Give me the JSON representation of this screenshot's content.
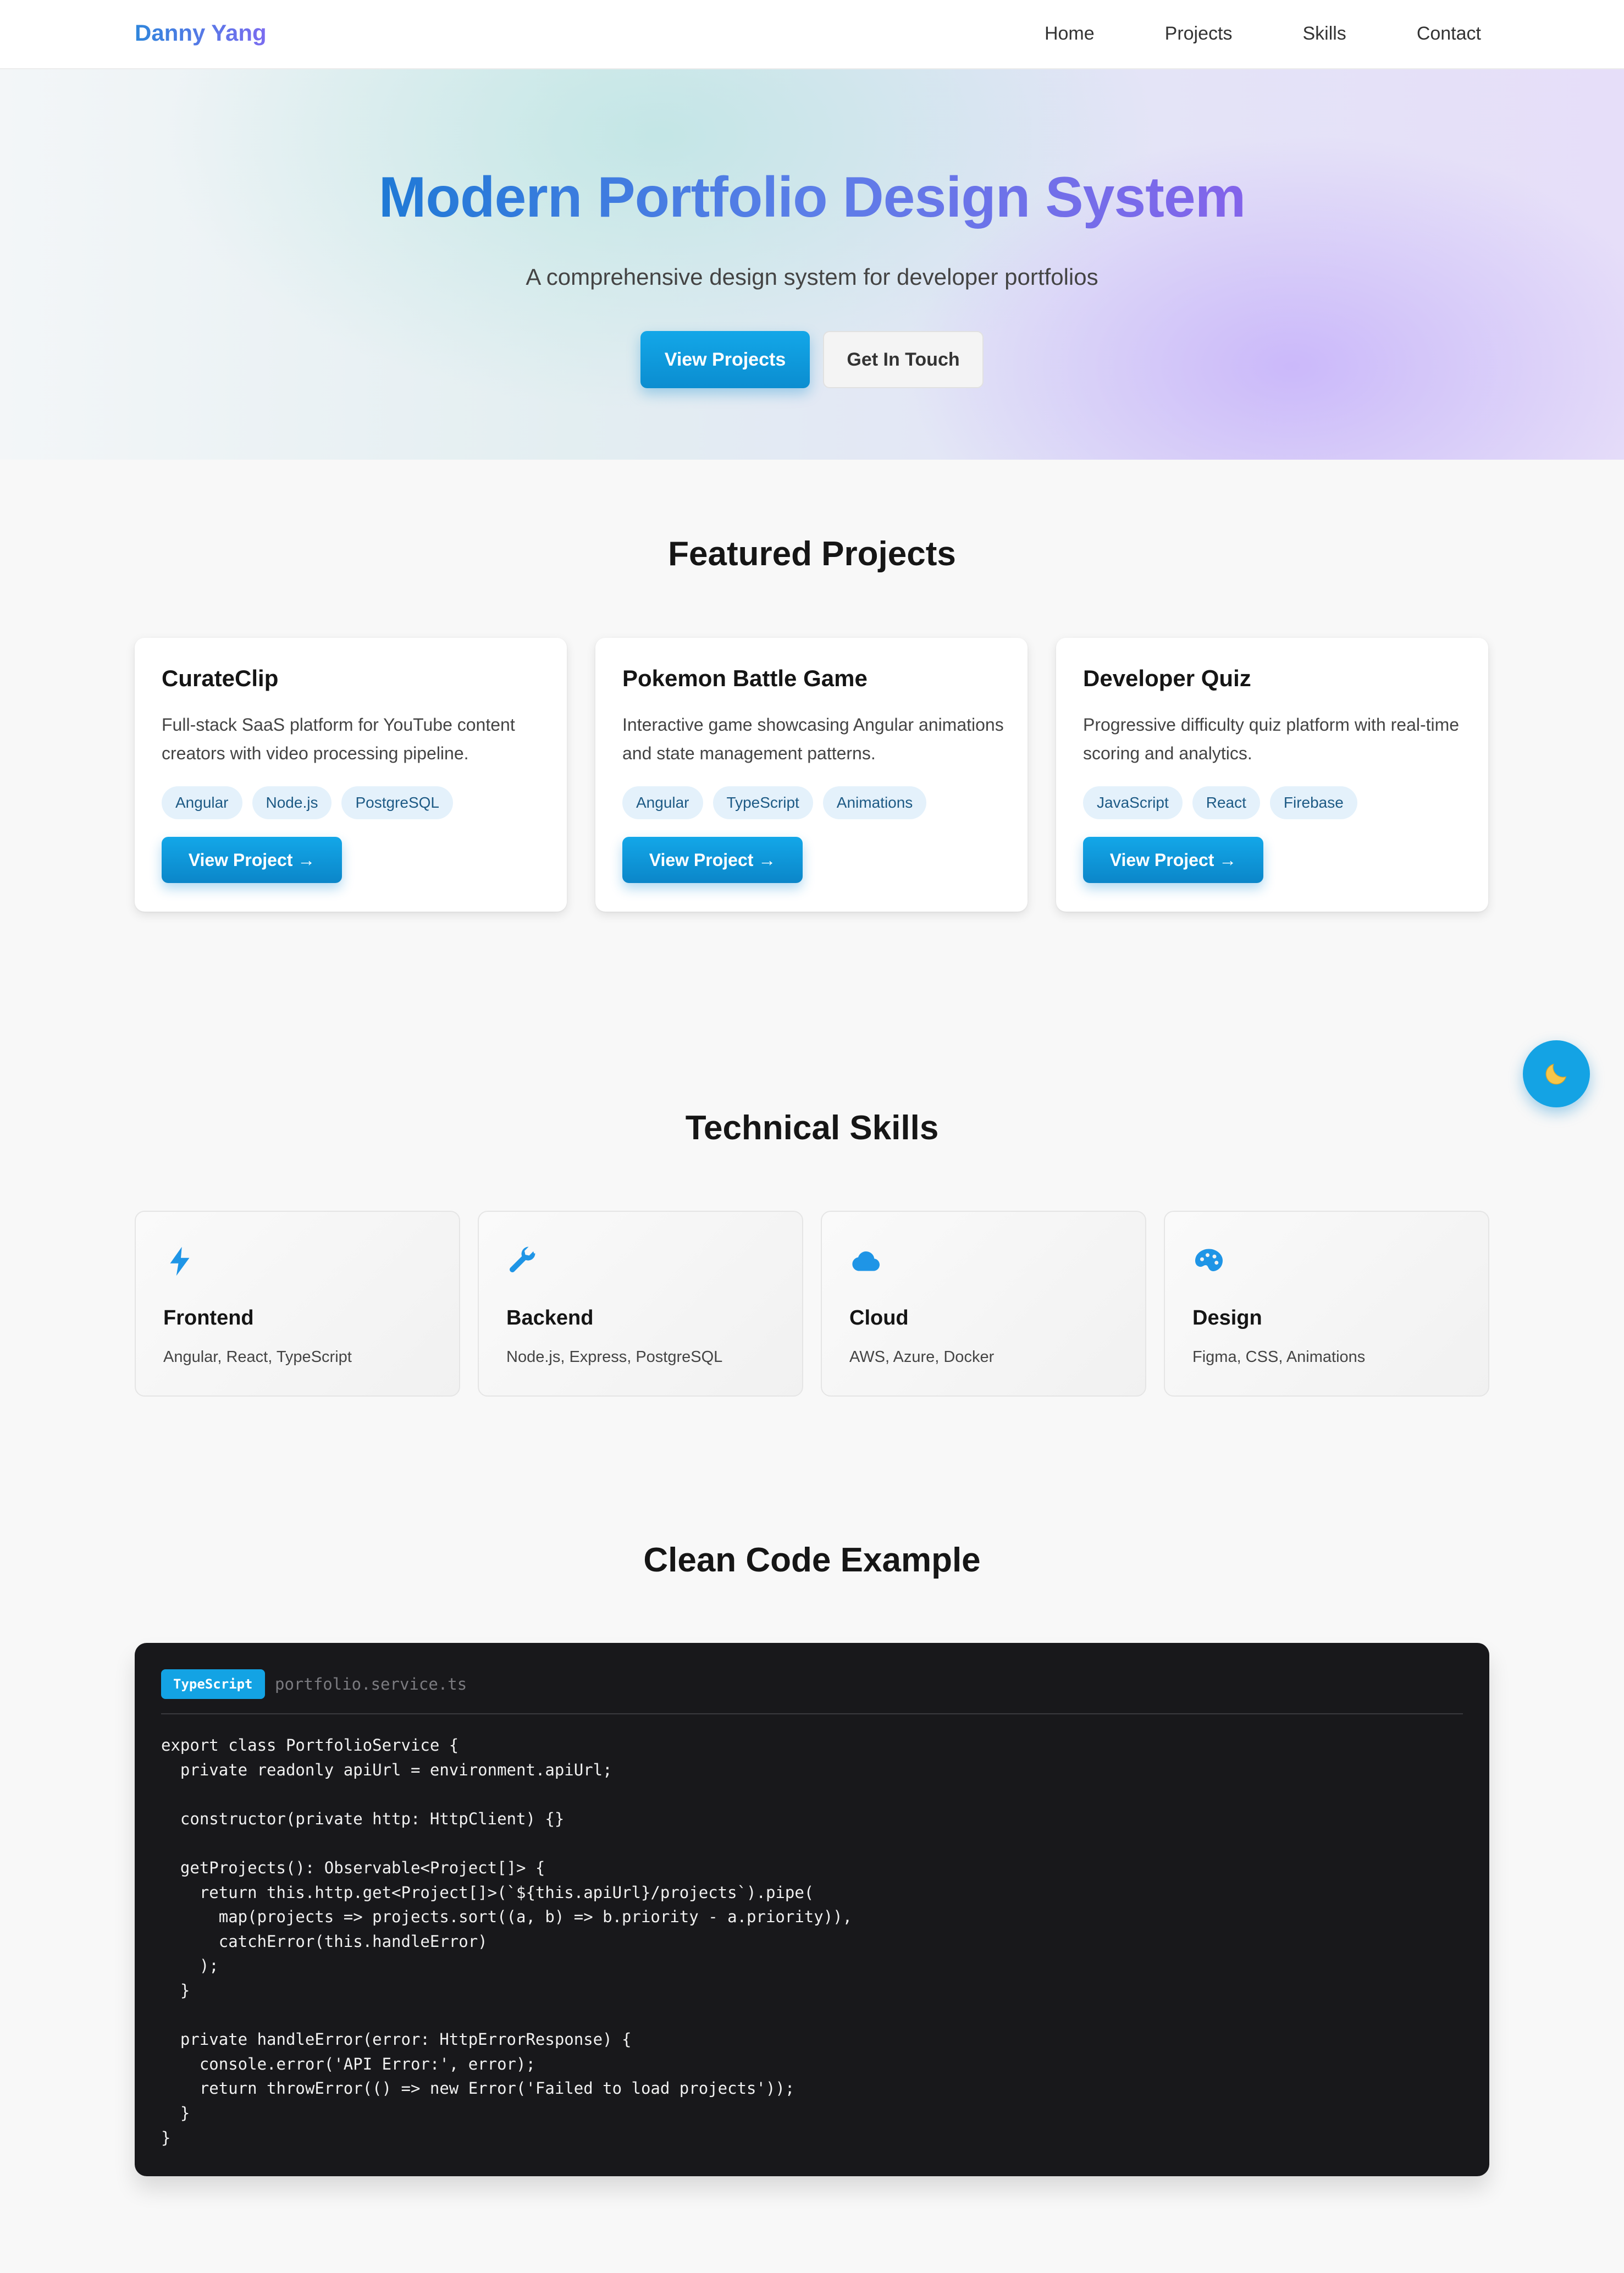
{
  "nav": {
    "brand": "Danny Yang",
    "links": [
      "Home",
      "Projects",
      "Skills",
      "Contact"
    ]
  },
  "hero": {
    "title": "Modern Portfolio Design System",
    "subtitle": "A comprehensive design system for developer portfolios",
    "primary_button": "View Projects",
    "secondary_button": "Get In Touch"
  },
  "projects": {
    "title": "Featured Projects",
    "cards": [
      {
        "title": "CurateClip",
        "description": "Full-stack SaaS platform for YouTube content creators with video processing pipeline.",
        "tags": [
          "Angular",
          "Node.js",
          "PostgreSQL"
        ],
        "button": "View Project →"
      },
      {
        "title": "Pokemon Battle Game",
        "description": "Interactive game showcasing Angular animations and state management patterns.",
        "tags": [
          "Angular",
          "TypeScript",
          "Animations"
        ],
        "button": "View Project →"
      },
      {
        "title": "Developer Quiz",
        "description": "Progressive difficulty quiz platform with real-time scoring and analytics.",
        "tags": [
          "JavaScript",
          "React",
          "Firebase"
        ],
        "button": "View Project →"
      }
    ]
  },
  "theme_toggle": {
    "icon": "moon-icon",
    "glyph": "🌙"
  },
  "skills": {
    "title": "Technical Skills",
    "items": [
      {
        "icon": "lightning-icon",
        "title": "Frontend",
        "description": "Angular, React, TypeScript"
      },
      {
        "icon": "wrench-icon",
        "title": "Backend",
        "description": "Node.js, Express, PostgreSQL"
      },
      {
        "icon": "cloud-icon",
        "title": "Cloud",
        "description": "AWS, Azure, Docker"
      },
      {
        "icon": "palette-icon",
        "title": "Design",
        "description": "Figma, CSS, Animations"
      }
    ]
  },
  "code": {
    "title": "Clean Code Example",
    "language": "TypeScript",
    "filename": "portfolio.service.ts",
    "lines": [
      "export class PortfolioService {",
      "  private readonly apiUrl = environment.apiUrl;",
      "",
      "  constructor(private http: HttpClient) {}",
      "",
      "  getProjects(): Observable<Project[]> {",
      "    return this.http.get<Project[]>(`${this.apiUrl}/projects`).pipe(",
      "      map(projects => projects.sort((a, b) => b.priority - a.priority)),",
      "      catchError(this.handleError)",
      "    );",
      "  }",
      "",
      "  private handleError(error: HttpErrorResponse) {",
      "    console.error('API Error:', error);",
      "    return throwError(() => new Error('Failed to load projects'));",
      "  }",
      "}"
    ]
  },
  "colors": {
    "accent": "#13a3e4",
    "skill_icon": "#1f95e6",
    "code_bg": "#18181b",
    "tag_bg": "#e4f1fb"
  }
}
